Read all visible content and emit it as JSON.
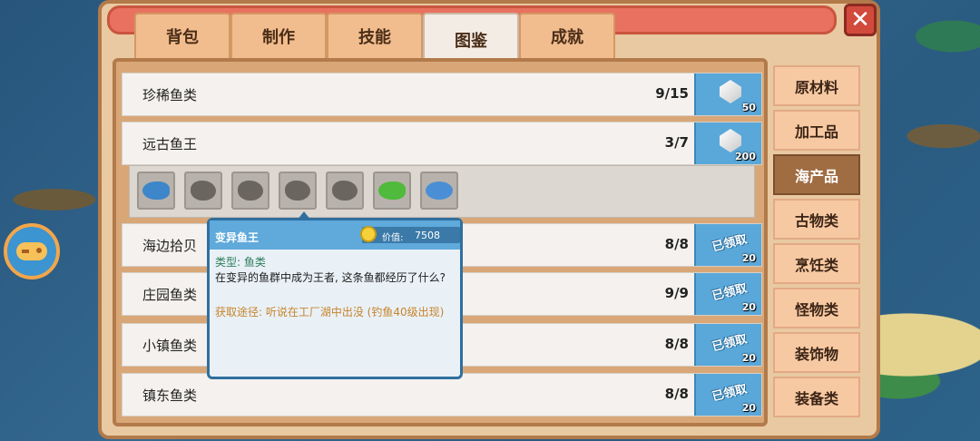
{
  "tabs": [
    {
      "label": "背包"
    },
    {
      "label": "制作"
    },
    {
      "label": "技能"
    },
    {
      "label": "图鉴",
      "active": true
    },
    {
      "label": "成就"
    }
  ],
  "close_label": "✕",
  "categories": [
    {
      "label": "原材料"
    },
    {
      "label": "加工品"
    },
    {
      "label": "海产品",
      "active": true
    },
    {
      "label": "古物类"
    },
    {
      "label": "烹饪类"
    },
    {
      "label": "怪物类"
    },
    {
      "label": "装饰物"
    },
    {
      "label": "装备类"
    }
  ],
  "rows": [
    {
      "name": "珍稀鱼类",
      "count": "9/15",
      "reward": "50",
      "claimed": false
    },
    {
      "name": "远古鱼王",
      "count": "3/7",
      "reward": "200",
      "claimed": false
    },
    {
      "name": "海边拾贝",
      "count": "8/8",
      "reward": "20",
      "claimed": true
    },
    {
      "name": "庄园鱼类",
      "count": "9/9",
      "reward": "20",
      "claimed": true
    },
    {
      "name": "小镇鱼类",
      "count": "8/8",
      "reward": "20",
      "claimed": true
    },
    {
      "name": "镇东鱼类",
      "count": "8/8",
      "reward": "20",
      "claimed": true
    }
  ],
  "claimed_label": "已领取",
  "fish_slots": [
    {
      "icon": "blue-shark-icon",
      "discovered": true,
      "color": "#3d86c9"
    },
    {
      "icon": "locked-fish-icon",
      "discovered": false
    },
    {
      "icon": "locked-fish-icon",
      "discovered": false
    },
    {
      "icon": "locked-fish-icon",
      "discovered": false
    },
    {
      "icon": "locked-fish-icon",
      "discovered": false
    },
    {
      "icon": "green-fish-icon",
      "discovered": true,
      "color": "#4fba3b"
    },
    {
      "icon": "blue-pufferfish-icon",
      "discovered": true,
      "color": "#4a8fd6"
    }
  ],
  "tooltip": {
    "title": "变异鱼王",
    "value_label": "价值:",
    "value": "7508",
    "type_line": "类型: 鱼类",
    "description": "在变异的鱼群中成为王者, 这条鱼都经历了什么?",
    "source": "获取途径: 听说在工厂湖中出没 (钓鱼40级出现)"
  },
  "colors": {
    "panel": "#e9c9a1",
    "reward_blue": "#5aa8d9",
    "active_category": "#a06c42",
    "close_red": "#d24a3c"
  }
}
